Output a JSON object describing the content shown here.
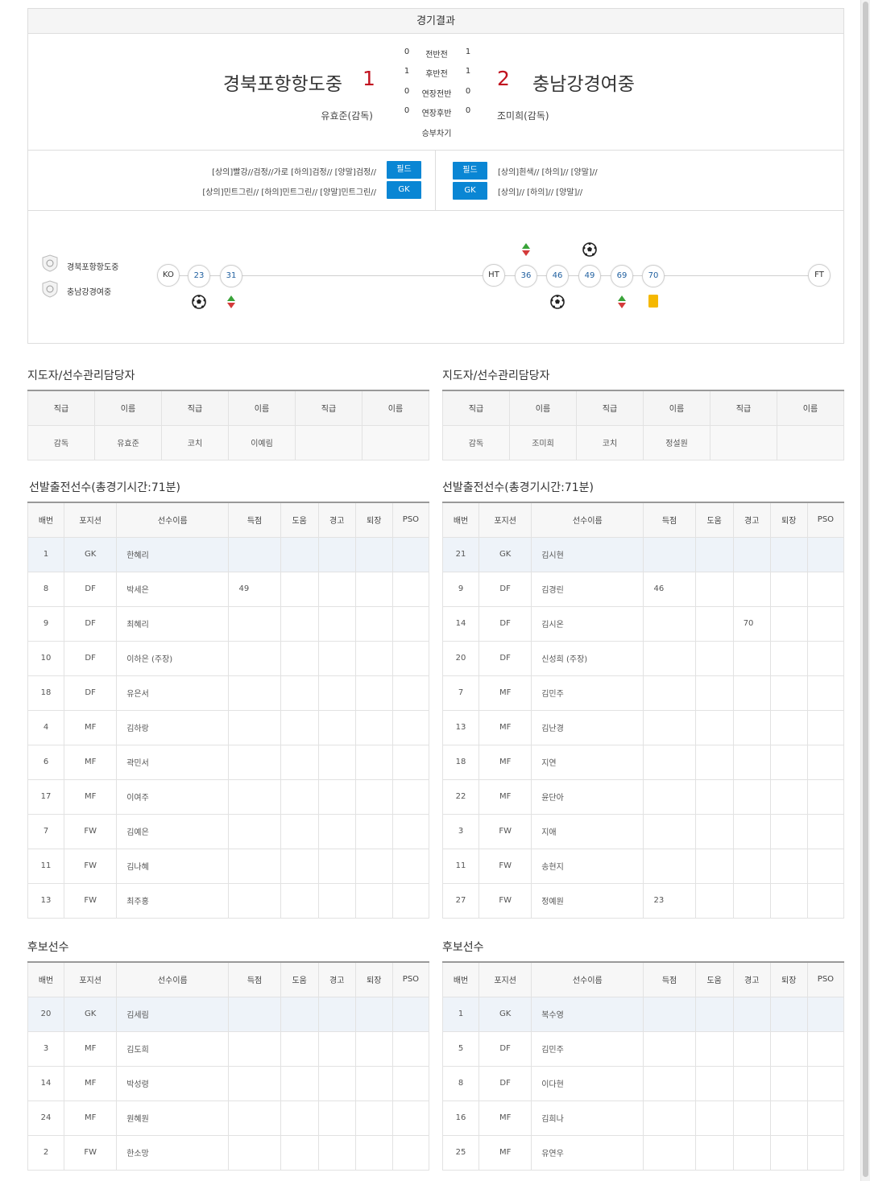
{
  "result": {
    "title": "경기결과",
    "home": {
      "name": "경북포항항도중",
      "score": "1",
      "coach": "유효준(감독)"
    },
    "away": {
      "name": "충남강경여중",
      "score": "2",
      "coach": "조미희(감독)"
    },
    "periods": [
      {
        "label": "전반전",
        "home": "0",
        "away": "1"
      },
      {
        "label": "후반전",
        "home": "1",
        "away": "1"
      },
      {
        "label": "연장전반",
        "home": "0",
        "away": "0"
      },
      {
        "label": "연장후반",
        "home": "0",
        "away": "0"
      },
      {
        "label": "승부차기",
        "home": "",
        "away": ""
      }
    ]
  },
  "uniforms": {
    "home": {
      "field_text": "[상의]빨강//검정//가로 [하의]검정// [양말]검정//",
      "gk_text": "[상의]민트그린// [하의]민트그린// [양말]민트그린//"
    },
    "away": {
      "field_text": "[상의]흰색// [하의]// [양말]//",
      "gk_text": "[상의]// [하의]// [양말]//"
    },
    "field_label": "필드",
    "gk_label": "GK"
  },
  "timeline": {
    "home_team": "경북포항항도중",
    "away_team": "충남강경여중",
    "markers": {
      "ko": "KO",
      "ht": "HT",
      "ft": "FT"
    },
    "minutes": [
      "23",
      "31",
      "36",
      "46",
      "49",
      "69",
      "70"
    ],
    "events_top": [
      {
        "minute": "36",
        "type": "substitution-icon"
      },
      {
        "minute": "49",
        "type": "soccer-ball-icon"
      }
    ],
    "events_bottom": [
      {
        "minute": "23",
        "type": "soccer-ball-icon"
      },
      {
        "minute": "31",
        "type": "substitution-icon"
      },
      {
        "minute": "46",
        "type": "soccer-ball-icon"
      },
      {
        "minute": "69",
        "type": "substitution-icon"
      },
      {
        "minute": "70",
        "type": "yellow-card-icon"
      }
    ],
    "colors": {
      "card": "#f5b800",
      "sub_up": "#39a339",
      "sub_down": "#d43a3a"
    }
  },
  "staff_title": "지도자/선수관리담당자",
  "staff_headers": [
    "직급",
    "이름",
    "직급",
    "이름",
    "직급",
    "이름"
  ],
  "staff": {
    "home": [
      "감독",
      "유효준",
      "코치",
      "이예림",
      "",
      ""
    ],
    "away": [
      "감독",
      "조미희",
      "코치",
      "정설원",
      "",
      ""
    ]
  },
  "starters_title": "선발출전선수(총경기시간:71분)",
  "subs_title": "후보선수",
  "player_headers": [
    "배번",
    "포지션",
    "선수이름",
    "득점",
    "도움",
    "경고",
    "퇴장",
    "PSO"
  ],
  "home_starters": [
    [
      "1",
      "GK",
      "한혜리",
      "",
      "",
      "",
      "",
      ""
    ],
    [
      "8",
      "DF",
      "박세은",
      "49",
      "",
      "",
      "",
      ""
    ],
    [
      "9",
      "DF",
      "최혜리",
      "",
      "",
      "",
      "",
      ""
    ],
    [
      "10",
      "DF",
      "이하은 (주장)",
      "",
      "",
      "",
      "",
      ""
    ],
    [
      "18",
      "DF",
      "유은서",
      "",
      "",
      "",
      "",
      ""
    ],
    [
      "4",
      "MF",
      "김하랑",
      "",
      "",
      "",
      "",
      ""
    ],
    [
      "6",
      "MF",
      "곽민서",
      "",
      "",
      "",
      "",
      ""
    ],
    [
      "17",
      "MF",
      "이여주",
      "",
      "",
      "",
      "",
      ""
    ],
    [
      "7",
      "FW",
      "김예은",
      "",
      "",
      "",
      "",
      ""
    ],
    [
      "11",
      "FW",
      "김나혜",
      "",
      "",
      "",
      "",
      ""
    ],
    [
      "13",
      "FW",
      "최주홍",
      "",
      "",
      "",
      "",
      ""
    ]
  ],
  "away_starters": [
    [
      "21",
      "GK",
      "김시현",
      "",
      "",
      "",
      "",
      ""
    ],
    [
      "9",
      "DF",
      "김경린",
      "46",
      "",
      "",
      "",
      ""
    ],
    [
      "14",
      "DF",
      "김시온",
      "",
      "",
      "70",
      "",
      ""
    ],
    [
      "20",
      "DF",
      "신성희 (주장)",
      "",
      "",
      "",
      "",
      ""
    ],
    [
      "7",
      "MF",
      "김민주",
      "",
      "",
      "",
      "",
      ""
    ],
    [
      "13",
      "MF",
      "김난경",
      "",
      "",
      "",
      "",
      ""
    ],
    [
      "18",
      "MF",
      "지연",
      "",
      "",
      "",
      "",
      ""
    ],
    [
      "22",
      "MF",
      "윤단아",
      "",
      "",
      "",
      "",
      ""
    ],
    [
      "3",
      "FW",
      "지애",
      "",
      "",
      "",
      "",
      ""
    ],
    [
      "11",
      "FW",
      "송현지",
      "",
      "",
      "",
      "",
      ""
    ],
    [
      "27",
      "FW",
      "정예원",
      "23",
      "",
      "",
      "",
      ""
    ]
  ],
  "home_subs": [
    [
      "20",
      "GK",
      "김세림",
      "",
      "",
      "",
      "",
      ""
    ],
    [
      "3",
      "MF",
      "김도희",
      "",
      "",
      "",
      "",
      ""
    ],
    [
      "14",
      "MF",
      "박성령",
      "",
      "",
      "",
      "",
      ""
    ],
    [
      "24",
      "MF",
      "원혜원",
      "",
      "",
      "",
      "",
      ""
    ],
    [
      "2",
      "FW",
      "한소망",
      "",
      "",
      "",
      "",
      ""
    ]
  ],
  "away_subs": [
    [
      "1",
      "GK",
      "복수영",
      "",
      "",
      "",
      "",
      ""
    ],
    [
      "5",
      "DF",
      "김민주",
      "",
      "",
      "",
      "",
      ""
    ],
    [
      "8",
      "DF",
      "이다현",
      "",
      "",
      "",
      "",
      ""
    ],
    [
      "16",
      "MF",
      "김희나",
      "",
      "",
      "",
      "",
      ""
    ],
    [
      "25",
      "MF",
      "유연우",
      "",
      "",
      "",
      "",
      ""
    ]
  ]
}
